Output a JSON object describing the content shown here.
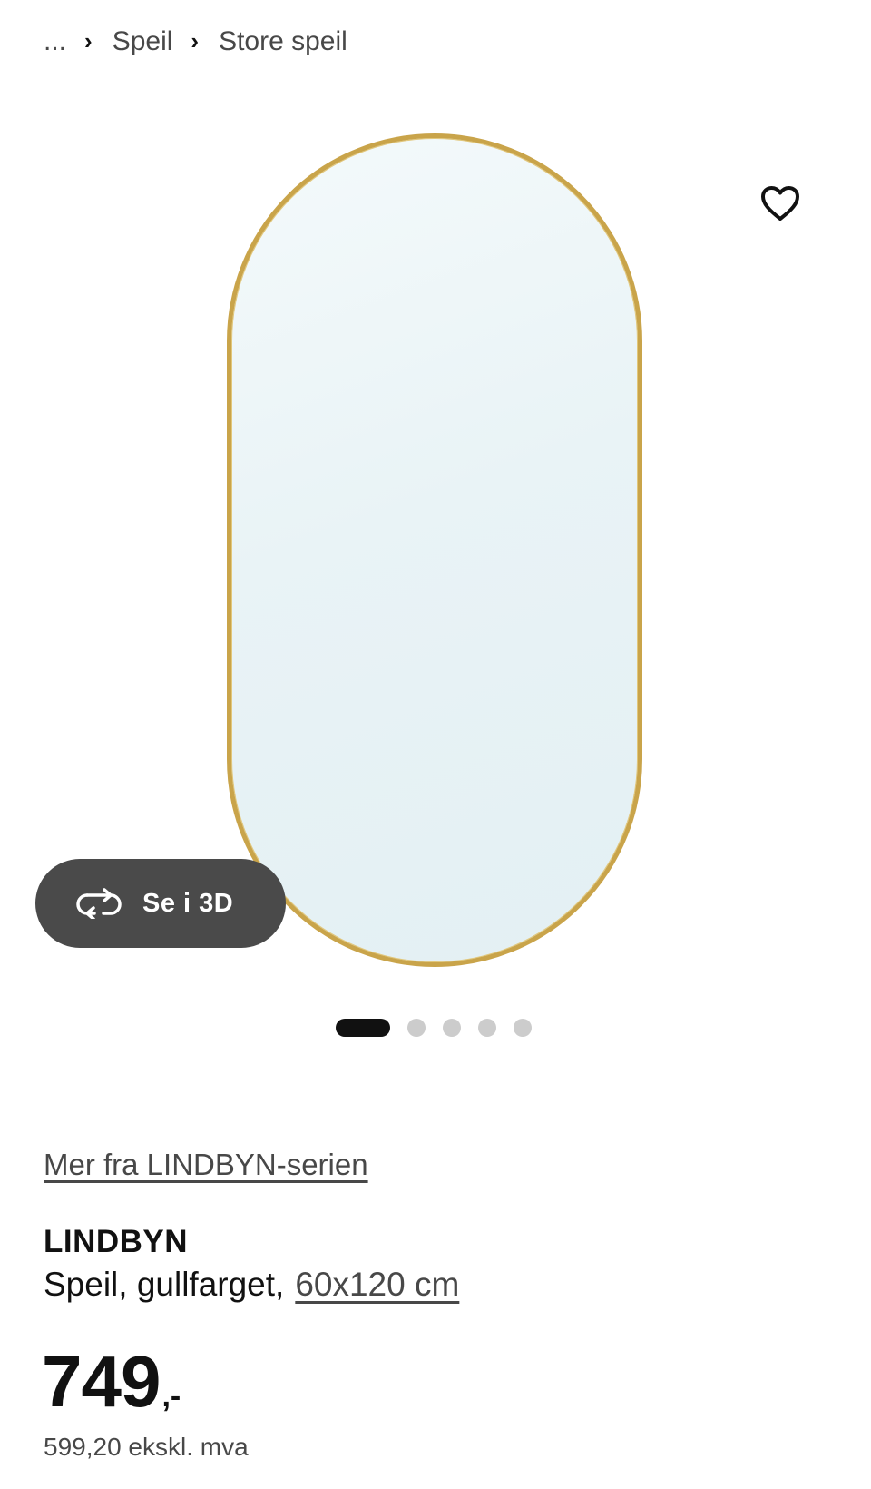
{
  "breadcrumb": {
    "ellipsis": "...",
    "separator": "›",
    "items": [
      {
        "label": "Speil"
      },
      {
        "label": "Store speil"
      }
    ]
  },
  "gallery": {
    "view3d_label": "Se i 3D",
    "icons": {
      "favorite": "heart-outline-icon",
      "view3d": "rotate-3d-icon"
    },
    "total_slides": 5,
    "active_slide": 1,
    "colors": {
      "frame": "#c9a44a",
      "button_bg": "#4a4a4a",
      "dot_active": "#111111",
      "dot_inactive": "#cccccc"
    }
  },
  "product": {
    "series_link": "Mer fra LINDBYN-serien",
    "name": "LINDBYN",
    "description": "Speil, gullfarget,",
    "size": "60x120 cm",
    "price": {
      "amount": "749",
      "suffix": ",-",
      "ex_vat": "599,20 ekskl. mva"
    }
  }
}
